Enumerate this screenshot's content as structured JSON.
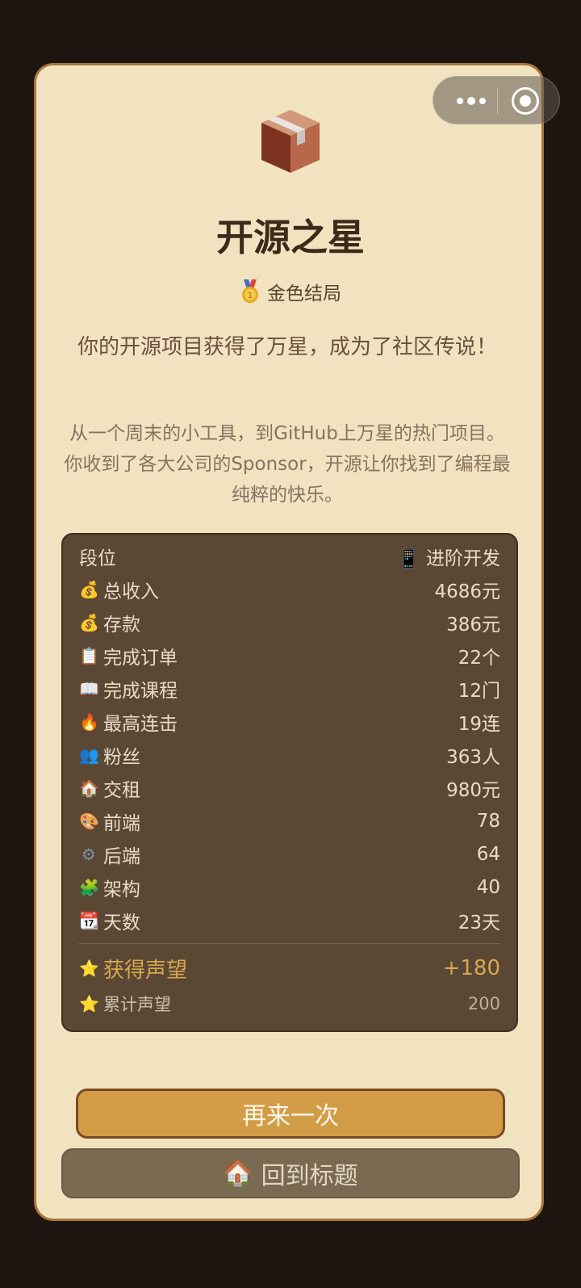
{
  "header": {
    "title": "开源之星",
    "ending_label": "金色结局",
    "ending_icon": "gold-medal-icon"
  },
  "description": {
    "headline": "你的开源项目获得了万星，成为了社区传说！",
    "body": "从一个周末的小工具，到GitHub上万星的热门项目。你收到了各大公司的Sponsor，开源让你找到了编程最纯粹的快乐。"
  },
  "stats": {
    "rank": {
      "label": "段位",
      "value": "📱 进阶开发"
    },
    "rows": [
      {
        "icon": "money-bag-icon",
        "emoji": "💰",
        "label": "总收入",
        "value": "4686元"
      },
      {
        "icon": "money-bag-icon",
        "emoji": "💰",
        "label": "存款",
        "value": "386元"
      },
      {
        "icon": "clipboard-icon",
        "emoji": "📋",
        "label": "完成订单",
        "value": "22个"
      },
      {
        "icon": "book-icon",
        "emoji": "📖",
        "label": "完成课程",
        "value": "12门"
      },
      {
        "icon": "fire-icon",
        "emoji": "🔥",
        "label": "最高连击",
        "value": "19连"
      },
      {
        "icon": "people-icon",
        "emoji": "👥",
        "label": "粉丝",
        "value": "363人"
      },
      {
        "icon": "house-icon",
        "emoji": "🏠",
        "label": "交租",
        "value": "980元"
      },
      {
        "icon": "palette-icon",
        "emoji": "🎨",
        "label": "前端",
        "value": "78"
      },
      {
        "icon": "gear-icon",
        "emoji": "⚙",
        "label": "后端",
        "value": "64"
      },
      {
        "icon": "puzzle-icon",
        "emoji": "🧩",
        "label": "架构",
        "value": "40"
      },
      {
        "icon": "calendar-icon",
        "emoji": "📆",
        "label": "天数",
        "value": "23天"
      }
    ],
    "gain": {
      "icon": "star-icon",
      "emoji": "⭐",
      "label": "获得声望",
      "value": "+180"
    },
    "total": {
      "icon": "star-icon",
      "emoji": "⭐",
      "label": "累计声望",
      "value": "200"
    }
  },
  "buttons": {
    "again": "再来一次",
    "home": "回到标题",
    "home_icon": "house-icon",
    "home_emoji": "🏠"
  },
  "colors": {
    "card_bg": "#f2e3c0",
    "panel_bg": "#5b4834",
    "accent": "#d39d47",
    "gain": "#d8a850"
  }
}
